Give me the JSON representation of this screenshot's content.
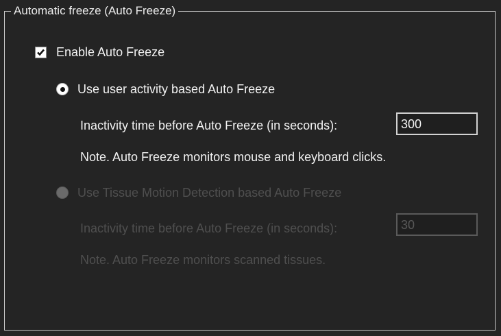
{
  "group": {
    "title": "Automatic freeze (Auto Freeze)"
  },
  "enable_checkbox": {
    "label": "Enable Auto Freeze",
    "checked": true
  },
  "user_activity_option": {
    "label": "Use user activity based Auto Freeze",
    "selected": true,
    "inactivity_label": "Inactivity time before Auto Freeze (in seconds):",
    "inactivity_value": "300",
    "note": "Note. Auto Freeze monitors mouse and keyboard clicks."
  },
  "tissue_motion_option": {
    "label": "Use Tissue Motion Detection based Auto Freeze",
    "selected": false,
    "enabled": false,
    "inactivity_label": "Inactivity time before Auto Freeze (in seconds):",
    "inactivity_value": "30",
    "note": "Note. Auto Freeze monitors scanned tissues."
  },
  "colors": {
    "background": "#242424",
    "text_enabled": "#f2f2f2",
    "text_disabled": "#4f4f4f",
    "frame": "#c9c9c9"
  }
}
